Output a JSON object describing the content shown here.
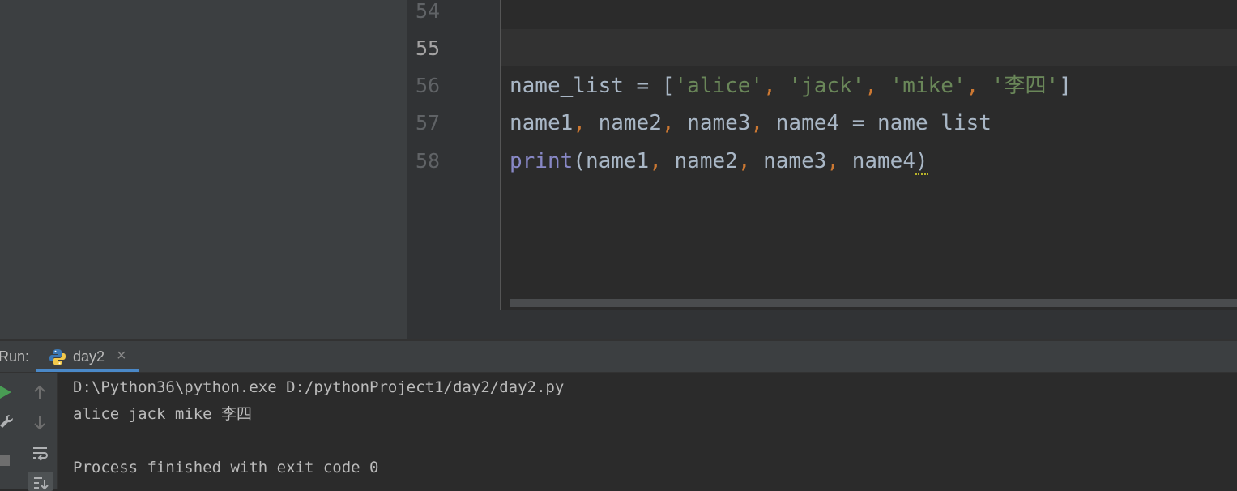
{
  "editor": {
    "lines": [
      {
        "number": "54",
        "code": ""
      },
      {
        "number": "55",
        "code": ""
      },
      {
        "number": "56",
        "code": "name_list = ['alice', 'jack', 'mike', '李四']"
      },
      {
        "number": "57",
        "code": "name1, name2, name3, name4 = name_list"
      },
      {
        "number": "58",
        "code": "print(name1, name2, name3, name4)"
      }
    ],
    "tokens": {
      "name_list": "name_list",
      "eq": " = ",
      "lbr": "[",
      "rbr": "]",
      "comma": ", ",
      "s1": "'alice'",
      "s2": "'jack'",
      "s3": "'mike'",
      "s4": "'李四'",
      "name1": "name1",
      "name2": "name2",
      "name3": "name3",
      "name4": "name4",
      "print": "print",
      "lpar": "(",
      "rpar": ")"
    }
  },
  "run_panel": {
    "label": "Run:",
    "tab_name": "day2",
    "close_glyph": "×",
    "icons": [
      "python-icon",
      "close-icon",
      "run-icon",
      "wrench-icon",
      "stop-icon",
      "scroll-up-icon",
      "scroll-down-icon",
      "soft-wrap-icon",
      "scroll-to-end-icon"
    ],
    "console_lines": [
      "D:\\Python36\\python.exe D:/pythonProject1/day2/day2.py",
      "alice jack mike 李四",
      "",
      "Process finished with exit code 0"
    ]
  },
  "colors": {
    "background": "#2b2b2b",
    "panel": "#3c3f41",
    "string": "#6a8759",
    "punctuation": "#cc7832",
    "builtin": "#8888c6",
    "text": "#a9b7c6",
    "tab_underline": "#4a88c7"
  }
}
